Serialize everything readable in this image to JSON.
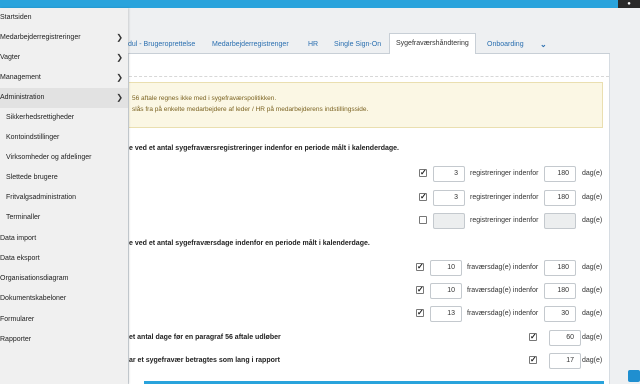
{
  "topbar": {
    "corner": "●"
  },
  "tabs": [
    {
      "label": "dul - Brugeroprettelse",
      "active": false
    },
    {
      "label": "Medarbejderregistrenger",
      "active": false
    },
    {
      "label": "HR",
      "active": false
    },
    {
      "label": "Single Sign-On",
      "active": false
    },
    {
      "label": "Sygefraværshåndtering",
      "active": true
    },
    {
      "label": "Onboarding",
      "active": false
    },
    {
      "label": "⌄",
      "active": false
    }
  ],
  "info": {
    "line1": "56 aftale regnes ikke med i sygefraværspolitikken.",
    "line2": "slås fra på enkelte medarbejdere af leder / HR på medarbejderens indstillingsside."
  },
  "section1": {
    "title": "e ved et antal sygefraværsregistreringer indenfor en periode målt i kalenderdage.",
    "rows": [
      {
        "checked": true,
        "count": "3",
        "text": "registreringer indenfor",
        "days": "180",
        "unit": "dag(e)",
        "disabled": false
      },
      {
        "checked": true,
        "count": "3",
        "text": "registreringer indenfor",
        "days": "180",
        "unit": "dag(e)",
        "disabled": false
      },
      {
        "checked": false,
        "count": "",
        "text": "registreringer indenfor",
        "days": "",
        "unit": "dag(e)",
        "disabled": true
      }
    ]
  },
  "section2": {
    "title": "e ved et antal sygefraværsdage indenfor en periode målt i kalenderdage.",
    "rows": [
      {
        "checked": true,
        "count": "10",
        "text": "fraværsdag(e) indenfor",
        "days": "180",
        "unit": "dag(e)"
      },
      {
        "checked": true,
        "count": "10",
        "text": "fraværsdag(e) indenfor",
        "days": "180",
        "unit": "dag(e)"
      },
      {
        "checked": true,
        "count": "13",
        "text": "fraværsdag(e) indenfor",
        "days": "30",
        "unit": "dag(e)"
      }
    ]
  },
  "row56": {
    "label": "et antal dage før en paragraf 56 aftale udløber",
    "checked": true,
    "value": "60",
    "unit": "dag(e)"
  },
  "rowLong": {
    "label": "ar et sygefravær betragtes som lang i rapport",
    "checked": true,
    "value": "17",
    "unit": "dag(e)"
  },
  "sidebar": {
    "items": [
      {
        "label": "Startsiden",
        "arrow": false,
        "sub": false
      },
      {
        "label": "Medarbejderregistreringer",
        "arrow": true,
        "sub": false
      },
      {
        "label": "Vagter",
        "arrow": true,
        "sub": false
      },
      {
        "label": "Management",
        "arrow": true,
        "sub": false
      },
      {
        "label": "Administration",
        "arrow": true,
        "sub": false
      },
      {
        "label": "Sikkerhedsrettigheder",
        "arrow": false,
        "sub": true
      },
      {
        "label": "Kontoindstillinger",
        "arrow": false,
        "sub": true
      },
      {
        "label": "Virksomheder og afdelinger",
        "arrow": false,
        "sub": true
      },
      {
        "label": "Slettede brugere",
        "arrow": false,
        "sub": true
      },
      {
        "label": "Fritvalgsadministration",
        "arrow": false,
        "sub": true
      },
      {
        "label": "Terminaller",
        "arrow": false,
        "sub": true
      },
      {
        "label": "Data import",
        "arrow": false,
        "sub": false
      },
      {
        "label": "Data eksport",
        "arrow": false,
        "sub": false
      },
      {
        "label": "Organisationsdiagram",
        "arrow": false,
        "sub": false
      },
      {
        "label": "Dokumentskabeloner",
        "arrow": false,
        "sub": false
      },
      {
        "label": "Formularer",
        "arrow": false,
        "sub": false
      },
      {
        "label": "Rapporter",
        "arrow": false,
        "sub": false
      }
    ],
    "arrowGlyph": "❯"
  }
}
